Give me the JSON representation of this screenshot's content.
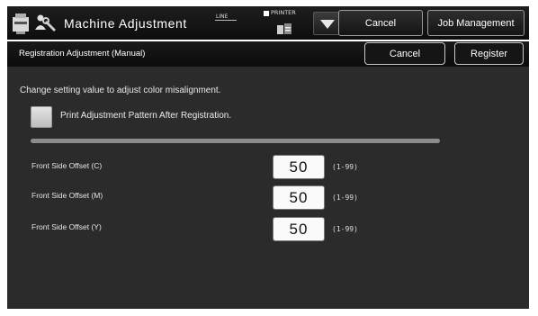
{
  "header": {
    "title": "Machine Adjustment",
    "line_label": "LINE",
    "printer_label": "PRINTER",
    "cancel_label": "Cancel",
    "job_management_label": "Job Management"
  },
  "subheader": {
    "title": "Registration Adjustment (Manual)",
    "cancel_label": "Cancel",
    "register_label": "Register"
  },
  "main": {
    "instruction": "Change setting value to adjust color misalignment.",
    "checkbox_label": "Print Adjustment Pattern After Registration.",
    "checkbox_checked": false,
    "offsets": [
      {
        "label": "Front Side Offset (C)",
        "value": "50",
        "range": "(1-99)"
      },
      {
        "label": "Front Side Offset (M)",
        "value": "50",
        "range": "(1-99)"
      },
      {
        "label": "Front Side Offset (Y)",
        "value": "50",
        "range": "(1-99)"
      }
    ]
  },
  "icons": {
    "app": "machine-adjustment-icon",
    "printer": "printer-icon",
    "menu": "triangle-down-icon"
  },
  "colors": {
    "top_bar": "#111111",
    "panel": "#2b2b2b",
    "value_box": "#fafafa"
  }
}
